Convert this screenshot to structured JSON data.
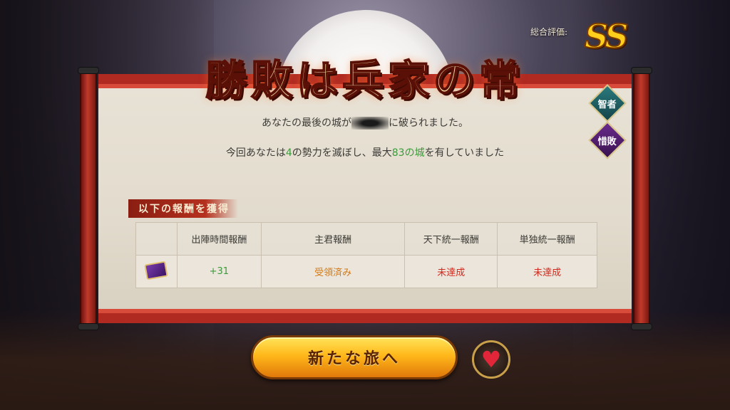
{
  "rating": {
    "label": "総合評価:",
    "value": "SS"
  },
  "title": "勝敗は兵家の常",
  "message": {
    "line1_prefix": "あなたの最後の城が",
    "line1_suffix": "に破られました。",
    "line2_part1": "今回あなたは",
    "line2_count1": "4",
    "line2_part2": "の勢力を滅ぼし、最大",
    "line2_count2": "83の城",
    "line2_part3": "を有していました"
  },
  "side_badges": [
    "智者",
    "惜敗"
  ],
  "rewards": {
    "heading": "以下の報酬を獲得",
    "columns": [
      "出陣時間報酬",
      "主君報酬",
      "天下統一報酬",
      "単独統一報酬"
    ],
    "row": [
      "+31",
      "受領済み",
      "未達成",
      "未達成"
    ]
  },
  "buttons": {
    "start": "新たな旅へ"
  },
  "icons": {
    "reward_item": "purple-scroll-icon",
    "heart": "heart-icon"
  },
  "colors": {
    "green": "#3c9a3a",
    "orange": "#d07a1a",
    "red": "#d22a1e",
    "scroll_red": "#b02a22"
  }
}
